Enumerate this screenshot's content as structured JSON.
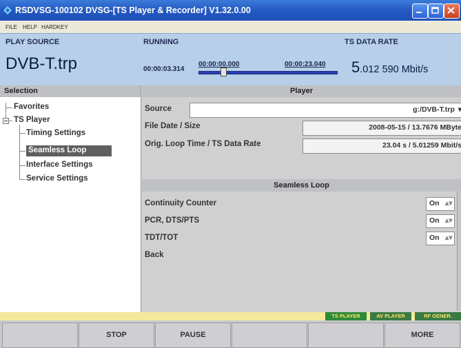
{
  "window": {
    "title": "RSDVSG-100102  DVSG-[TS Player & Recorder]  V1.32.0.00"
  },
  "menu": [
    "FILE",
    "HELP",
    "HARDKEY"
  ],
  "header": {
    "play_source_label": "PLAY SOURCE",
    "play_source_value": "DVB-T.trp",
    "running_label": "RUNNING",
    "elapsed": "00:00:03.314",
    "start": "00:00:00.000",
    "end": "00:00:23.040",
    "progress": 0.18,
    "data_rate_label": "TS DATA RATE",
    "data_rate_value_major": "5",
    "data_rate_value_rest": ".012 590 Mbit/s"
  },
  "selection": {
    "header": "Selection",
    "tree": [
      {
        "label": "Favorites",
        "level": 1
      },
      {
        "label": "TS Player",
        "level": 1,
        "expanded": true
      },
      {
        "label": "Timing Settings",
        "level": 2
      },
      {
        "label": "Seamless Loop",
        "level": 2,
        "selected": true
      },
      {
        "label": "Interface Settings",
        "level": 2
      },
      {
        "label": "Service Settings",
        "level": 2
      }
    ]
  },
  "player": {
    "header": "Player",
    "source_label": "Source",
    "source_value": "g:/DVB-T.trp",
    "file_date_label": "File Date / Size",
    "file_date_value": "2008-05-15 / 13.7676 MByte",
    "loop_time_label": "Orig. Loop Time / TS Data Rate",
    "loop_time_value": "23.04 s / 5.01259 Mbit/s"
  },
  "seamless_loop": {
    "header": "Seamless Loop",
    "rows": [
      {
        "label": "Continuity Counter",
        "value": "On"
      },
      {
        "label": "PCR, DTS/PTS",
        "value": "On"
      },
      {
        "label": "TDT/TOT",
        "value": "On"
      }
    ],
    "back_label": "Back"
  },
  "status_tabs": [
    "TS PLAYER",
    "AV PLAYER",
    "RF GENER."
  ],
  "softkeys": [
    "",
    "STOP",
    "PAUSE",
    "",
    "",
    "MORE"
  ],
  "colors": {
    "title_blue": "#2459c2",
    "header_blue": "#b7cfe9",
    "selected_bg": "#5f5f5f",
    "tab_green": "#2f8a3a",
    "tab_text": "#ffe36a"
  }
}
